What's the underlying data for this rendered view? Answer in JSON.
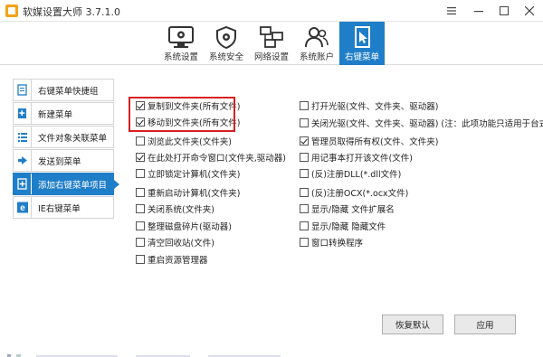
{
  "window": {
    "title": "软媒设置大师 3.7.1.0",
    "minimize_icon": "minimize-icon",
    "maximize_icon": "maximize-icon",
    "close_icon": "close-icon"
  },
  "toolbar": {
    "items": [
      {
        "label": "系统设置",
        "icon": "monitor-gear-icon",
        "active": false
      },
      {
        "label": "系统安全",
        "icon": "shield-gear-icon",
        "active": false
      },
      {
        "label": "网络设置",
        "icon": "network-icon",
        "active": false
      },
      {
        "label": "系统账户",
        "icon": "users-icon",
        "active": false
      },
      {
        "label": "右键菜单",
        "icon": "cursor-page-icon",
        "active": true
      }
    ],
    "accent_color": "#1f7ec8"
  },
  "sidebar": {
    "items": [
      {
        "label": "右键菜单快捷组",
        "icon": "page-icon",
        "active": false
      },
      {
        "label": "新建菜单",
        "icon": "new-page-icon",
        "active": false
      },
      {
        "label": "文件对象关联菜单",
        "icon": "list-icon",
        "active": false
      },
      {
        "label": "发送到菜单",
        "icon": "send-arrow-icon",
        "active": false
      },
      {
        "label": "添加右键菜单项目",
        "icon": "add-icon",
        "active": true
      },
      {
        "label": "IE右键菜单",
        "icon": "ie-icon",
        "active": false
      }
    ]
  },
  "options": {
    "left": [
      {
        "label": "复制到文件夹(所有文件)",
        "checked": true
      },
      {
        "label": "移动到文件夹(所有文件)",
        "checked": true
      },
      {
        "label": "浏览此文件夹(文件夹)",
        "checked": false
      },
      {
        "label": "在此处打开命令窗口(文件夹,驱动器)",
        "checked": true
      },
      {
        "label": "立即锁定计算机(文件夹)",
        "checked": false
      },
      {
        "label": "重新启动计算机(文件夹)",
        "checked": false
      },
      {
        "label": "关闭系统(文件夹)",
        "checked": false
      },
      {
        "label": "整理磁盘碎片(驱动器)",
        "checked": false
      },
      {
        "label": "清空回收站(文件)",
        "checked": false
      },
      {
        "label": "重启资源管理器",
        "checked": false
      }
    ],
    "right": [
      {
        "label": "打开光驱(文件、文件夹、驱动器)",
        "checked": false
      },
      {
        "label": "关闭光驱(文件、文件夹、驱动器) (注：此项功能只适用于台式机)",
        "checked": false
      },
      {
        "label": "管理员取得所有权(文件、文件夹)",
        "checked": true
      },
      {
        "label": "用记事本打开该文件(文件)",
        "checked": false
      },
      {
        "label": "(反)注册DLL(*.dll文件)",
        "checked": false
      },
      {
        "label": "(反)注册OCX(*.ocx文件)",
        "checked": false
      },
      {
        "label": "显示/隐藏 文件扩展名",
        "checked": false
      },
      {
        "label": "显示/隐藏 隐藏文件",
        "checked": false
      },
      {
        "label": "窗口转换程序",
        "checked": false
      }
    ]
  },
  "highlight_color": "#d92020",
  "footer": {
    "restore_label": "恢复默认",
    "apply_label": "应用"
  }
}
